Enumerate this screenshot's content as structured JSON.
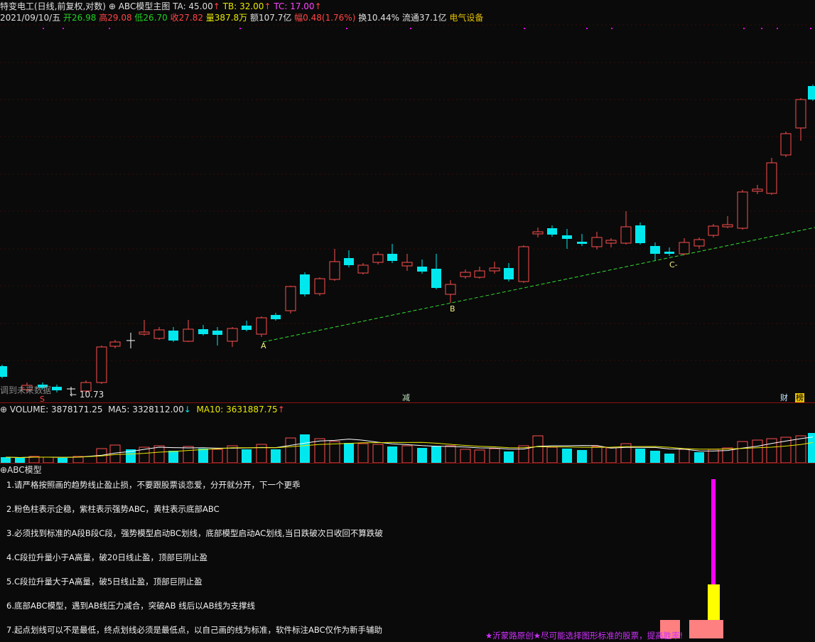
{
  "header": {
    "stock_name": "特变电工(日线,前复权,对数)",
    "indicator_icon": "circle-icon",
    "indicator_name": "ABC模型主图",
    "ta": "TA: 45.00",
    "tb": "TB: 32.00",
    "tc": "TC: 17.00",
    "arrow_up": "↑"
  },
  "quote": {
    "date": "2021/09/10/五",
    "open": "开26.98",
    "high": "高29.08",
    "low": "低26.70",
    "close": "收27.82",
    "volume": "量387.8万",
    "amount": "额107.7亿",
    "change": "幅0.48(1.76%)",
    "turnover": "换10.44%",
    "float_cap": "流通37.1亿",
    "sector": "电气设备"
  },
  "main_chart": {
    "labels": {
      "a": "A",
      "b": "B",
      "c": "C-"
    },
    "future_data_text": "调到未来数据",
    "low_price_label": "← 10.73",
    "marker_s": "S",
    "marker_jian": "减",
    "marker_cai": "财",
    "marker_bang": "榜",
    "colors": {
      "up": "#ff4d4d",
      "down": "#00e8ee",
      "trendline": "#33dd33"
    }
  },
  "volume_panel": {
    "title": "VOLUME: 3878171.25",
    "ma5": "MA5: 3328112.00",
    "ma5_arrow": "↓",
    "ma10": "MA10: 3631887.75",
    "ma10_arrow": "↑"
  },
  "abc_panel": {
    "title": "ABC模型",
    "tips": [
      "1.请严格按照画的趋势线止盈止损，不要跟股票谈恋爱，分开就分开，下一个更乖",
      "2.粉色柱表示企稳，紫柱表示强势ABC，黄柱表示底部ABC",
      "3.必须找到标准的A段B段C段，强势模型启动BC划线，底部模型启动AC划线,当日跌破次日收回不算跌破",
      "4.C段拉升量小于A高量，破20日线止盈，顶部巨阴止盈",
      "5.C段拉升量大于A高量，破5日线止盈，顶部巨阴止盈",
      "6.底部ABC模型，遇到AB线压力减合，突破AB 线后以AB线为支撑线",
      "7.起点划线可以不是最低，终点划线必须是最低点，以自己画的线为标准，软件标注ABC仅作为新手辅助"
    ],
    "footnote": "★沂蒙路原创★尽可能选择图形标准的股票，提高胜率!",
    "bar_colors": {
      "magenta": "#ff00ff",
      "yellow": "#ffff00",
      "pink": "#ff8080"
    }
  }
}
